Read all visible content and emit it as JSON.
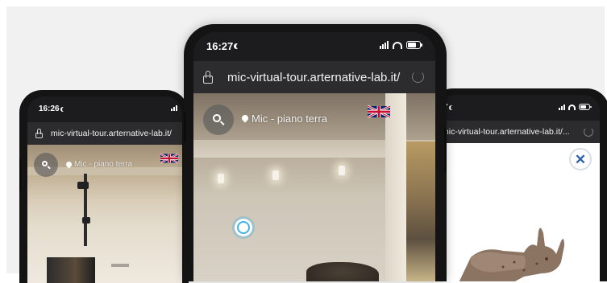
{
  "phones": {
    "left": {
      "time": "16:26",
      "url": "mic-virtual-tour.arternative-lab.it/",
      "location": "Mic - piano terra"
    },
    "center": {
      "time": "16:27",
      "url": "mic-virtual-tour.arternative-lab.it/",
      "location": "Mic - piano terra"
    },
    "right": {
      "time": "7",
      "url": "mic-virtual-tour.arternative-lab.it/...",
      "close_icon": "✕"
    }
  },
  "icons": {
    "search": "search-icon",
    "pin": "location-pin-icon",
    "flag": "uk-flag-icon",
    "lock": "lock-icon",
    "reload": "reload-icon",
    "close": "close-icon",
    "hotspot": "hotspot-icon"
  },
  "colors": {
    "phone_frame": "#141414",
    "url_bar": "#2c2c2e",
    "hotspot": "#3fb4e5",
    "close_accent": "#2d5fb0"
  }
}
